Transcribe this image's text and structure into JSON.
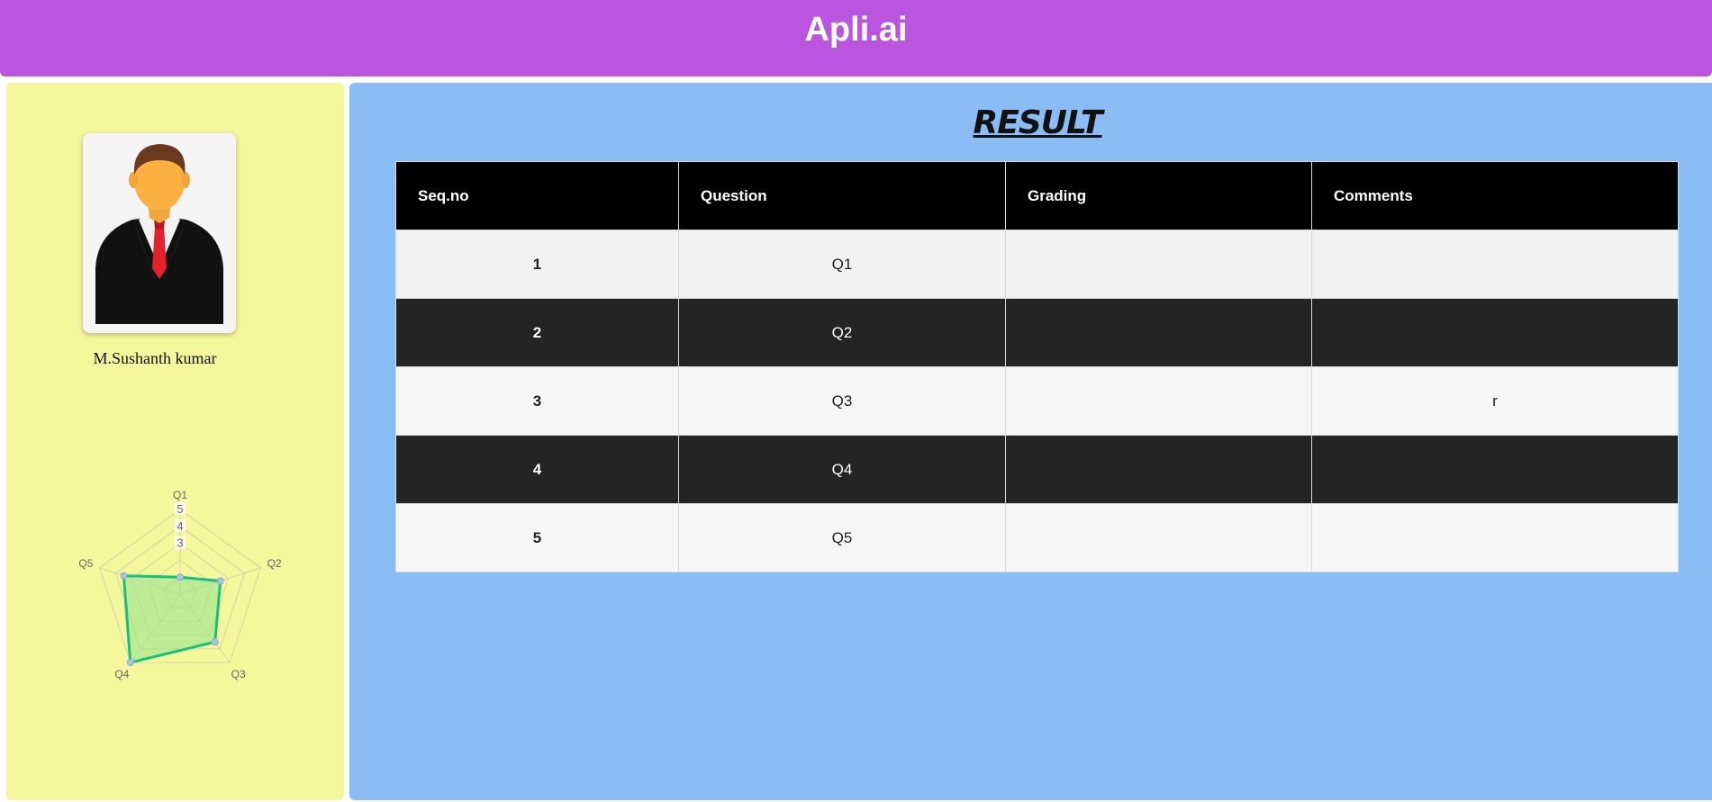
{
  "header": {
    "title": "Apli.ai"
  },
  "profile": {
    "name": "M.Sushanth kumar"
  },
  "radar_chart": {
    "axes": [
      "Q1",
      "Q2",
      "Q3",
      "Q4",
      "Q5"
    ],
    "scale_ticks": [
      "3",
      "4",
      "5"
    ],
    "values": [
      1.0,
      2.5,
      3.5,
      5.0,
      3.5
    ],
    "max": 5,
    "colors": {
      "line": "#14c27a",
      "fill": "#9be391",
      "grid": "#d6d6a6",
      "point": "#a9c6e6"
    }
  },
  "result": {
    "title": "RESULT",
    "columns": [
      "Seq.no",
      "Question",
      "Grading",
      "Comments"
    ],
    "rows": [
      {
        "seq": "1",
        "question": "Q1",
        "grading": "",
        "comments": ""
      },
      {
        "seq": "2",
        "question": "Q2",
        "grading": "",
        "comments": ""
      },
      {
        "seq": "3",
        "question": "Q3",
        "grading": "",
        "comments": "r"
      },
      {
        "seq": "4",
        "question": "Q4",
        "grading": "",
        "comments": ""
      },
      {
        "seq": "5",
        "question": "Q5",
        "grading": "",
        "comments": ""
      }
    ]
  },
  "colors": {
    "header": "#bb55e0",
    "sidebar": "#f4f79c",
    "main": "#8abdf5"
  }
}
